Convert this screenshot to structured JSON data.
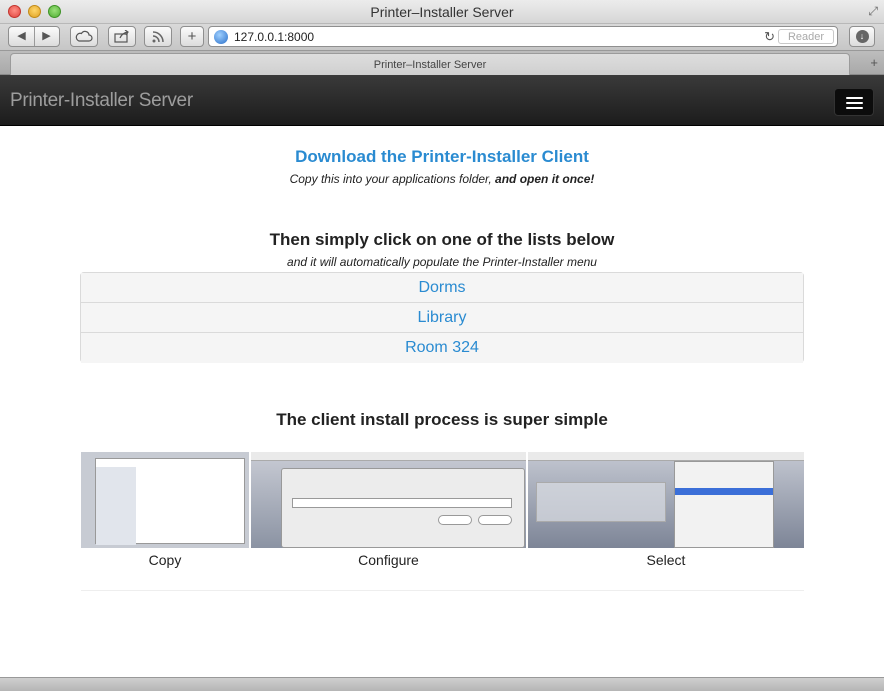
{
  "window": {
    "title": "Printer–Installer Server"
  },
  "toolbar": {
    "address": "127.0.0.1:8000",
    "reader_label": "Reader"
  },
  "tabs": [
    {
      "label": "Printer–Installer Server"
    }
  ],
  "navbar": {
    "brand": "Printer-Installer Server"
  },
  "download": {
    "link_text": "Download the Printer-Installer Client",
    "subtitle_prefix": "Copy this into your applications folder, ",
    "subtitle_bold": "and open it once!"
  },
  "lists": {
    "heading": "Then simply click on one of the lists below",
    "subtitle": "and it will automatically populate the Printer-Installer menu",
    "items": [
      {
        "label": "Dorms"
      },
      {
        "label": "Library"
      },
      {
        "label": "Room 324"
      }
    ]
  },
  "process": {
    "heading": "The client install process is super simple",
    "steps": [
      {
        "caption": "Copy"
      },
      {
        "caption": "Configure"
      },
      {
        "caption": "Select"
      }
    ]
  },
  "colors": {
    "link": "#2a8bd1",
    "navbar": "#222222"
  }
}
